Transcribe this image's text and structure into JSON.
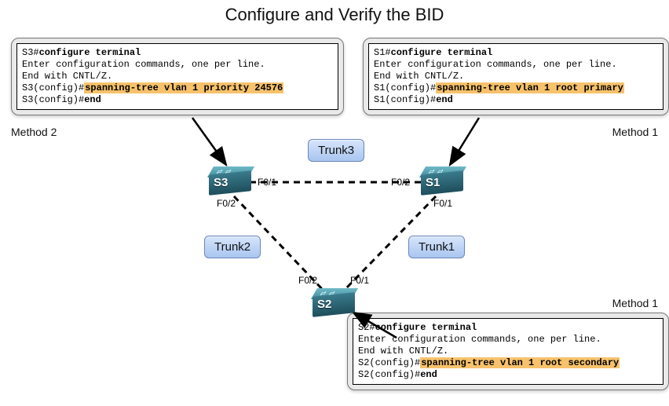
{
  "title": "Configure and Verify the BID",
  "terminals": {
    "s3": {
      "method_label": "Method 2",
      "lines": [
        {
          "pre": "S3#",
          "bold_pre": "configure terminal"
        },
        {
          "plain": "Enter configuration commands, one per line."
        },
        {
          "plain": "End with CNTL/Z."
        },
        {
          "pre": "S3(config)#",
          "hl": "spanning-tree vlan 1 priority 24576"
        },
        {
          "pre": "S3(config)#",
          "bold_pre": "end"
        }
      ]
    },
    "s1": {
      "method_label": "Method 1",
      "lines": [
        {
          "pre": "S1#",
          "bold_pre": "configure terminal"
        },
        {
          "plain": "Enter configuration commands, one per line."
        },
        {
          "plain": "End with CNTL/Z."
        },
        {
          "pre": "S1(config)#",
          "hl": "spanning-tree vlan 1 root primary"
        },
        {
          "pre": "S1(config)#",
          "bold_pre": "end"
        }
      ]
    },
    "s2": {
      "method_label": "Method 1",
      "lines": [
        {
          "pre": "S2#",
          "bold_pre": "configure terminal"
        },
        {
          "plain": "Enter configuration commands, one per line."
        },
        {
          "plain": "End with CNTL/Z."
        },
        {
          "pre": "S2(config)#",
          "hl": "spanning-tree vlan 1 root secondary"
        },
        {
          "pre": "S2(config)#",
          "bold_pre": "end"
        }
      ]
    }
  },
  "trunks": {
    "t1": "Trunk1",
    "t2": "Trunk2",
    "t3": "Trunk3"
  },
  "switches": {
    "s1": "S1",
    "s2": "S2",
    "s3": "S3"
  },
  "ports": {
    "s3_f01": "F0/1",
    "s3_f02": "F0/2",
    "s1_f01": "F0/1",
    "s1_f02": "F0/2",
    "s2_f01": "F0/1",
    "s2_f02": "F0/2"
  }
}
